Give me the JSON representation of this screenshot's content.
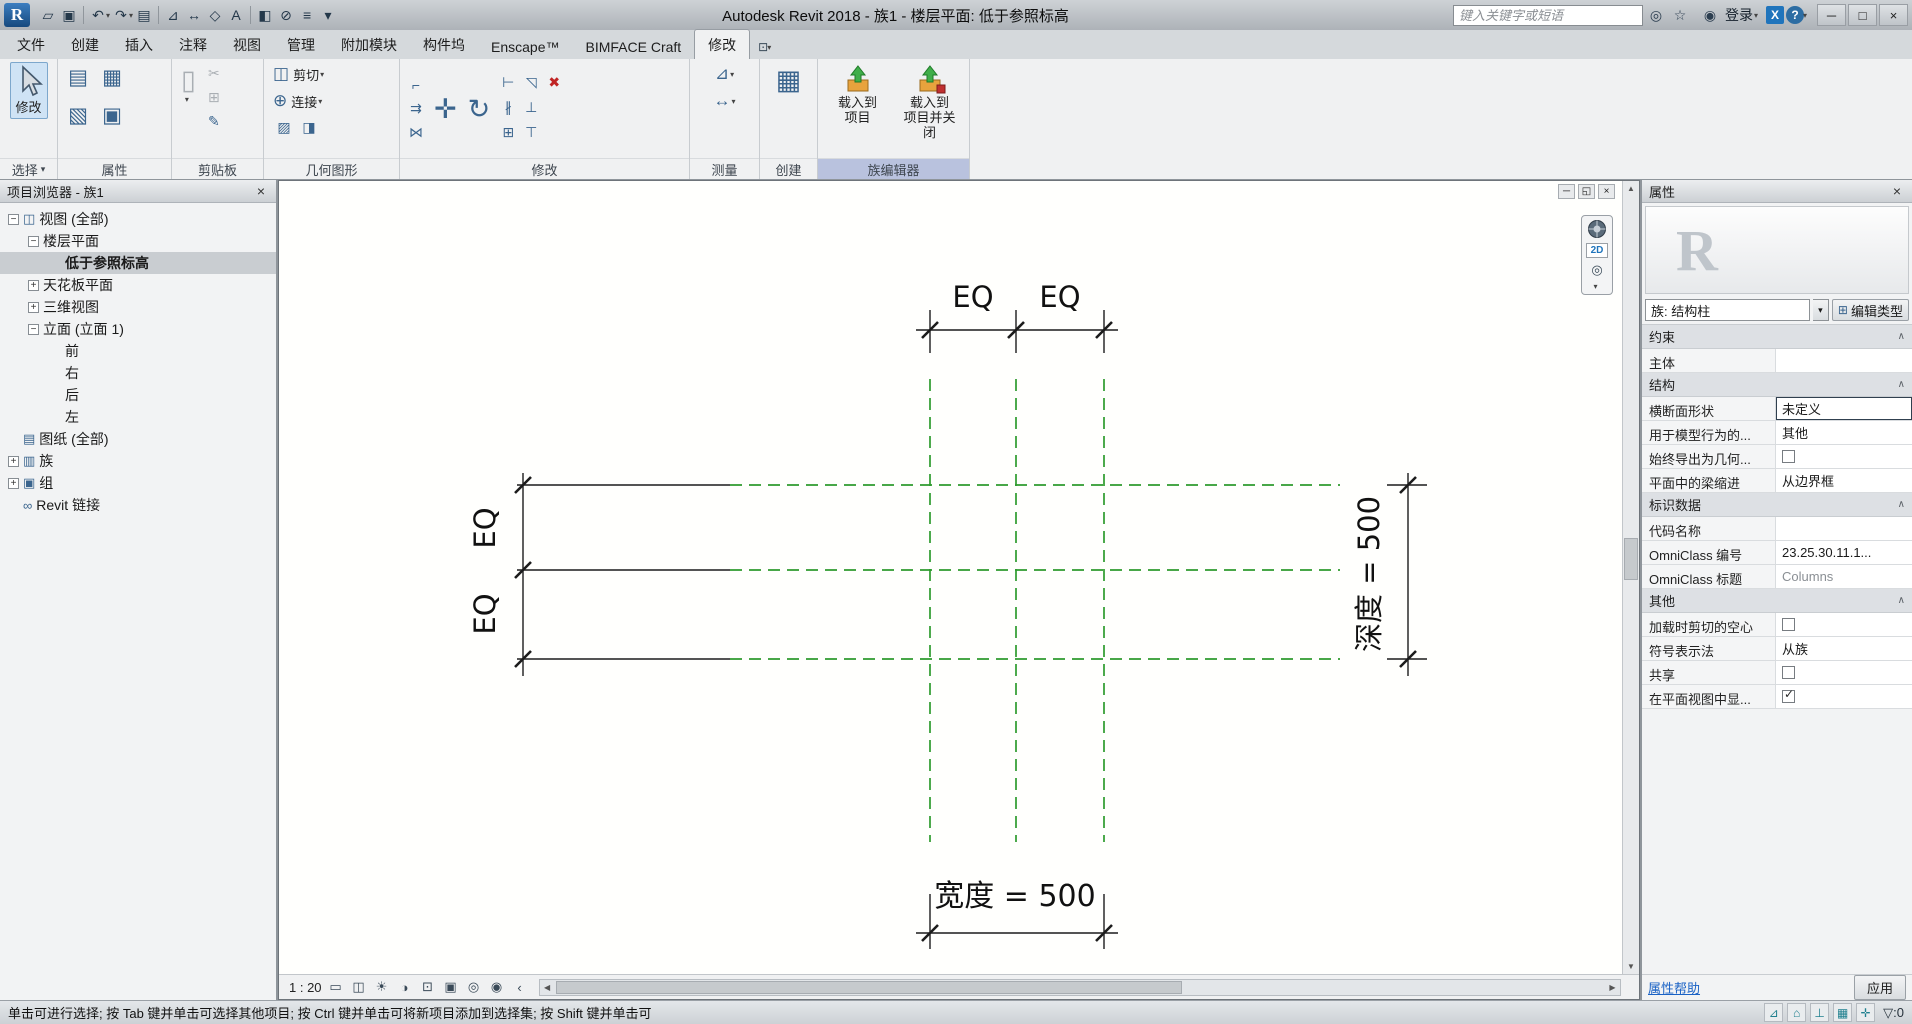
{
  "colors": {
    "ref-green": "#2e9b2e",
    "dim-black": "#1c1c1c",
    "accent-blue": "#1f74bc",
    "panel-highlight": "#b9c2de",
    "teal-icon": "#20808f"
  },
  "titlebar": {
    "app_initial": "R",
    "caret": "▾",
    "qat": [
      {
        "name": "open-file",
        "glyph": "▱"
      },
      {
        "name": "save",
        "glyph": "▣"
      },
      {
        "name": "undo",
        "glyph": "↶"
      },
      {
        "name": "redo",
        "glyph": "↷"
      },
      {
        "name": "print",
        "glyph": "▤"
      },
      {
        "name": "measure",
        "glyph": "⊿"
      },
      {
        "name": "aligned-dimension",
        "glyph": "↔"
      },
      {
        "name": "tag-by-category",
        "glyph": "◇"
      },
      {
        "name": "text-note",
        "glyph": "A"
      },
      {
        "name": "default-3d-view",
        "glyph": "◧"
      },
      {
        "name": "section",
        "glyph": "⊘"
      },
      {
        "name": "thin-lines",
        "glyph": "≡"
      },
      {
        "name": "customize-qat",
        "glyph": "▾"
      }
    ],
    "title": "Autodesk Revit 2018 - 族1 - 楼层平面: 低于参照标高",
    "search_placeholder": "键入关键字或短语",
    "search_icon": "◎",
    "favorites_icon": "☆",
    "signin": {
      "icon": "◉",
      "label": "登录"
    },
    "exchange_icon": "X",
    "help_icon": "?",
    "window": {
      "minimize": "─",
      "maximize": "□",
      "close": "×"
    }
  },
  "tabs": {
    "file": "文件",
    "items": [
      "创建",
      "插入",
      "注释",
      "视图",
      "管理",
      "附加模块",
      "构件坞",
      "Enscape™",
      "BIMFACE Craft",
      "修改"
    ],
    "display_icon": "⊡",
    "display_toggle": "▾"
  },
  "ribbon": {
    "select": {
      "label": "选择",
      "caret": "▾",
      "modify": "修改"
    },
    "properties": {
      "label": "属性",
      "icons": [
        {
          "name": "properties-palette",
          "glyph": "▤"
        },
        {
          "name": "family-types",
          "glyph": "▦"
        },
        {
          "name": "family-category-parameters",
          "glyph": "▧"
        },
        {
          "name": "type-properties",
          "glyph": "▣"
        }
      ]
    },
    "clipboard": {
      "label": "剪贴板",
      "paste_glyph": "▯",
      "cut_glyph": "✂",
      "copy_glyph": "⊞",
      "match_glyph": "✎"
    },
    "geometry": {
      "label": "几何图形",
      "cut": "剪切",
      "join": "连接",
      "cut_glyph": "◫",
      "join_glyph": "⊕",
      "extra": [
        {
          "name": "split-face",
          "glyph": "▨"
        },
        {
          "name": "paint",
          "glyph": "◨"
        }
      ]
    },
    "modify": {
      "label": "修改",
      "icons": [
        {
          "name": "align",
          "glyph": "⌐"
        },
        {
          "name": "offset",
          "glyph": "⇉"
        },
        {
          "name": "mirror",
          "glyph": "⋈"
        },
        {
          "name": "move",
          "glyph": "✛"
        },
        {
          "name": "rotate",
          "glyph": "↻"
        },
        {
          "name": "trim-extend",
          "glyph": "⊢"
        },
        {
          "name": "split-element",
          "glyph": "∦"
        },
        {
          "name": "array",
          "glyph": "⊞"
        },
        {
          "name": "scale",
          "glyph": "◹"
        },
        {
          "name": "pin",
          "glyph": "⊥"
        },
        {
          "name": "unpin",
          "glyph": "⊤"
        },
        {
          "name": "delete",
          "glyph": "✖"
        }
      ]
    },
    "measure": {
      "label": "测量",
      "measure_glyph": "⊿",
      "dim_glyph": "↔"
    },
    "create": {
      "label": "创建",
      "group_glyph": "▦"
    },
    "family_editor": {
      "label": "族编辑器",
      "load_line1": "载入到",
      "load_line2": "项目",
      "load_close_line1": "载入到",
      "load_close_line2": "项目并关闭"
    }
  },
  "project_browser": {
    "title": "项目浏览器 - 族1",
    "close": "×",
    "items": [
      {
        "exp": "−",
        "glyph": "◫",
        "label": "视图 (全部)"
      },
      {
        "exp": "−",
        "glyph": "",
        "label": "楼层平面"
      },
      {
        "exp": "",
        "glyph": "",
        "label": "低于参照标高"
      },
      {
        "exp": "+",
        "glyph": "",
        "label": "天花板平面"
      },
      {
        "exp": "+",
        "glyph": "",
        "label": "三维视图"
      },
      {
        "exp": "−",
        "glyph": "",
        "label": "立面 (立面 1)"
      },
      {
        "exp": "",
        "glyph": "",
        "label": "前"
      },
      {
        "exp": "",
        "glyph": "",
        "label": "右"
      },
      {
        "exp": "",
        "glyph": "",
        "label": "后"
      },
      {
        "exp": "",
        "glyph": "",
        "label": "左"
      },
      {
        "exp": "",
        "glyph": "▤",
        "label": "图纸 (全部)"
      },
      {
        "exp": "+",
        "glyph": "▥",
        "label": "族"
      },
      {
        "exp": "+",
        "glyph": "▣",
        "label": "组"
      },
      {
        "exp": "",
        "glyph": "∞",
        "label": "Revit 链接"
      }
    ]
  },
  "canvas": {
    "eq": "EQ",
    "width_label": "宽度 = 500",
    "depth_label": "深度 = 500",
    "scale": "1 : 20",
    "nav_2d": "2D",
    "window": {
      "minimize": "─",
      "restore": "◱",
      "close": "×"
    },
    "viewbar_icons": [
      {
        "name": "sheet-size",
        "glyph": "▭"
      },
      {
        "name": "visual-style",
        "glyph": "◫"
      },
      {
        "name": "sun-path",
        "glyph": "☀"
      },
      {
        "name": "shadows",
        "glyph": "◑"
      },
      {
        "name": "crop-view",
        "glyph": "⊡"
      },
      {
        "name": "show-crop-region",
        "glyph": "▣"
      },
      {
        "name": "temporary-hide-isolate",
        "glyph": "◎"
      },
      {
        "name": "reveal-hidden-elements",
        "glyph": "◉"
      }
    ],
    "viewbar_collapse": "‹"
  },
  "properties": {
    "header": "属性",
    "close": "×",
    "preview_letter": "R",
    "type_selector": "族: 结构柱",
    "combo_caret": "▾",
    "edit_type": "编辑类型",
    "edit_type_icon": "⊞",
    "group_chevron": "∧",
    "groups": [
      {
        "name": "约束",
        "rows": [
          {
            "label": "主体",
            "value": ""
          }
        ]
      },
      {
        "name": "结构",
        "rows": [
          {
            "label": "横断面形状",
            "value": "未定义"
          },
          {
            "label": "用于模型行为的...",
            "value": "其他"
          },
          {
            "label": "始终导出为几何...",
            "checked": false
          },
          {
            "label": "平面中的梁缩进",
            "value": "从边界框"
          }
        ]
      },
      {
        "name": "标识数据",
        "rows": [
          {
            "label": "代码名称",
            "value": ""
          },
          {
            "label": "OmniClass 编号",
            "value": "23.25.30.11.1..."
          },
          {
            "label": "OmniClass 标题",
            "value": "Columns"
          }
        ]
      },
      {
        "name": "其他",
        "rows": [
          {
            "label": "加载时剪切的空心",
            "checked": false
          },
          {
            "label": "符号表示法",
            "value": "从族"
          },
          {
            "label": "共享",
            "checked": false
          },
          {
            "label": "在平面视图中显...",
            "checked": true
          }
        ]
      }
    ],
    "help_link": "属性帮助",
    "apply_button": "应用"
  },
  "statusbar": {
    "prompt": "单击可进行选择; 按 Tab 键并单击可选择其他项目; 按 Ctrl 键并单击可将新项目添加到选择集; 按 Shift 键并单击可",
    "toggles": [
      {
        "name": "select-links",
        "glyph": "⊿"
      },
      {
        "name": "select-underlay-elements",
        "glyph": "⌂"
      },
      {
        "name": "select-pinned-elements",
        "glyph": "⊥"
      },
      {
        "name": "select-elements-by-face",
        "glyph": "▦"
      },
      {
        "name": "drag-elements-on-selection",
        "glyph": "✛"
      }
    ],
    "filter_count": "▽:0"
  }
}
